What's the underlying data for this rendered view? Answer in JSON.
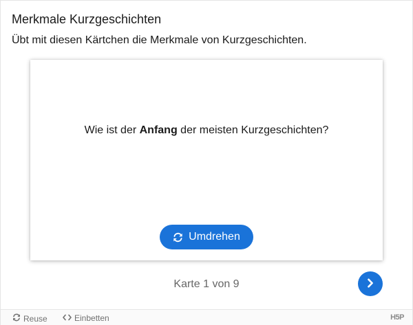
{
  "header": {
    "title": "Merkmale Kurzgeschichten",
    "description": "Übt mit diesen Kärtchen die Merkmale von Kurzgeschichten."
  },
  "card": {
    "question_before": "Wie ist der ",
    "question_bold": "Anfang",
    "question_after": " der meisten Kurzgeschichten?",
    "flip_label": "Umdrehen",
    "flip_icon": "refresh-icon"
  },
  "navigation": {
    "progress_text": "Karte 1 von 9",
    "current_card": 1,
    "total_cards": 9,
    "next_icon": "chevron-right-icon"
  },
  "footer": {
    "reuse_label": "Reuse",
    "embed_label": "Einbetten",
    "logo_text": "H5P"
  },
  "colors": {
    "accent": "#1a73d9",
    "text": "#1a1a1a",
    "muted": "#666666",
    "footer_bg": "#fafafa"
  }
}
